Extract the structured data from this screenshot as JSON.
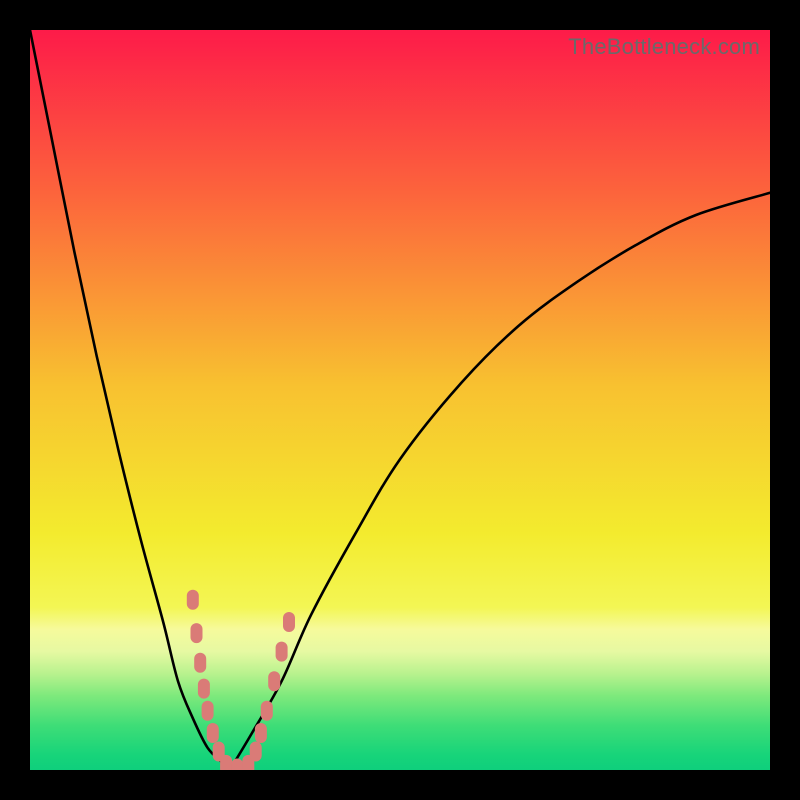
{
  "watermark": {
    "text": "TheBottleneck.com"
  },
  "chart_data": {
    "type": "line",
    "title": "",
    "xlabel": "",
    "ylabel": "",
    "xlim": [
      0,
      100
    ],
    "ylim": [
      0,
      100
    ],
    "grid": false,
    "legend": false,
    "series": [
      {
        "name": "left-curve",
        "x": [
          0,
          3,
          6,
          9,
          12,
          15,
          18,
          20,
          22,
          24,
          26,
          27
        ],
        "y": [
          100,
          85,
          70,
          56,
          43,
          31,
          20,
          12,
          7,
          3,
          1,
          0
        ]
      },
      {
        "name": "right-curve",
        "x": [
          27,
          30,
          34,
          38,
          44,
          50,
          58,
          66,
          74,
          82,
          90,
          100
        ],
        "y": [
          0,
          5,
          12,
          21,
          32,
          42,
          52,
          60,
          66,
          71,
          75,
          78
        ]
      }
    ],
    "markers": {
      "name": "plateau-markers",
      "color": "#da7b77",
      "points": [
        {
          "x": 22.0,
          "y": 23.0
        },
        {
          "x": 22.5,
          "y": 18.5
        },
        {
          "x": 23.0,
          "y": 14.5
        },
        {
          "x": 23.5,
          "y": 11.0
        },
        {
          "x": 24.0,
          "y": 8.0
        },
        {
          "x": 24.7,
          "y": 5.0
        },
        {
          "x": 25.5,
          "y": 2.5
        },
        {
          "x": 26.5,
          "y": 0.7
        },
        {
          "x": 28.0,
          "y": 0.2
        },
        {
          "x": 29.5,
          "y": 0.7
        },
        {
          "x": 30.5,
          "y": 2.5
        },
        {
          "x": 31.2,
          "y": 5.0
        },
        {
          "x": 32.0,
          "y": 8.0
        },
        {
          "x": 33.0,
          "y": 12.0
        },
        {
          "x": 34.0,
          "y": 16.0
        },
        {
          "x": 35.0,
          "y": 20.0
        }
      ]
    },
    "gradient_stops": [
      {
        "pct": 0,
        "color": "#fd1b49"
      },
      {
        "pct": 22,
        "color": "#fc643c"
      },
      {
        "pct": 48,
        "color": "#f8c130"
      },
      {
        "pct": 68,
        "color": "#f3eb2e"
      },
      {
        "pct": 78,
        "color": "#f3f654"
      },
      {
        "pct": 81,
        "color": "#f6fa9c"
      },
      {
        "pct": 84,
        "color": "#e6f9a2"
      },
      {
        "pct": 87,
        "color": "#b8f28e"
      },
      {
        "pct": 90,
        "color": "#7de97c"
      },
      {
        "pct": 94,
        "color": "#3edd77"
      },
      {
        "pct": 98,
        "color": "#17d47a"
      },
      {
        "pct": 100,
        "color": "#0fcf7c"
      }
    ]
  }
}
